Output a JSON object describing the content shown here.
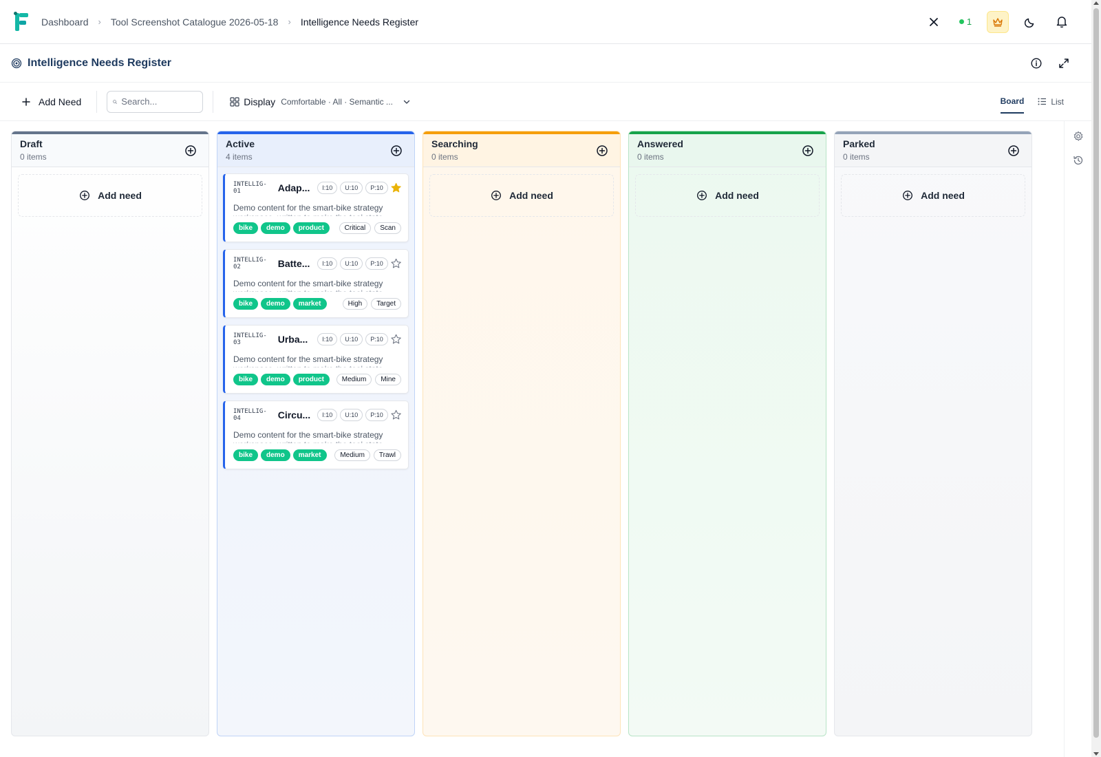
{
  "breadcrumbs": {
    "home": "Dashboard",
    "catalogue": "Tool Screenshot Catalogue 2026-05-18",
    "current": "Intelligence Needs Register"
  },
  "header": {
    "online_count": "1"
  },
  "page": {
    "title": "Intelligence Needs Register"
  },
  "toolbar": {
    "add_label": "Add Need",
    "search_placeholder": "Search...",
    "display_label": "Display",
    "display_meta": "Comfortable · All · Semantic ...",
    "tab_board": "Board",
    "tab_list": "List"
  },
  "columns": [
    {
      "title": "Draft",
      "count": "0 items",
      "add_label": "Add need",
      "color": "#64748b"
    },
    {
      "title": "Active",
      "count": "4 items",
      "color": "#2563eb"
    },
    {
      "title": "Searching",
      "count": "0 items",
      "add_label": "Add need",
      "color": "#f59e0b"
    },
    {
      "title": "Answered",
      "count": "0 items",
      "add_label": "Add need",
      "color": "#16a34a"
    },
    {
      "title": "Parked",
      "count": "0 items",
      "add_label": "Add need",
      "color": "#94a3b8"
    }
  ],
  "cards": [
    {
      "id": "INTELLIG-01",
      "title": "Adap...",
      "i": "I:10",
      "u": "U:10",
      "p": "P:10",
      "starred": true,
      "desc": "Demo content for the smart-bike strategy",
      "desc_cut": "workspace, written to make the tool state",
      "tags": [
        "bike",
        "demo",
        "product"
      ],
      "priority": "Critical",
      "method": "Scan"
    },
    {
      "id": "INTELLIG-02",
      "title": "Batte...",
      "i": "I:10",
      "u": "U:10",
      "p": "P:10",
      "starred": false,
      "desc": "Demo content for the smart-bike strategy",
      "desc_cut": "workspace, written to make the tool state",
      "tags": [
        "bike",
        "demo",
        "market"
      ],
      "priority": "High",
      "method": "Target"
    },
    {
      "id": "INTELLIG-03",
      "title": "Urba...",
      "i": "I:10",
      "u": "U:10",
      "p": "P:10",
      "starred": false,
      "desc": "Demo content for the smart-bike strategy",
      "desc_cut": "workspace, written to make the tool state",
      "tags": [
        "bike",
        "demo",
        "product"
      ],
      "priority": "Medium",
      "method": "Mine"
    },
    {
      "id": "INTELLIG-04",
      "title": "Circu...",
      "i": "I:10",
      "u": "U:10",
      "p": "P:10",
      "starred": false,
      "desc": "Demo content for the smart-bike strategy",
      "desc_cut": "workspace, written to make the tool state",
      "tags": [
        "bike",
        "demo",
        "market"
      ],
      "priority": "Medium",
      "method": "Trawl"
    }
  ],
  "colors": {
    "accent": "#1e3a5f",
    "tag": "#10c58a",
    "star": "#eab308"
  }
}
